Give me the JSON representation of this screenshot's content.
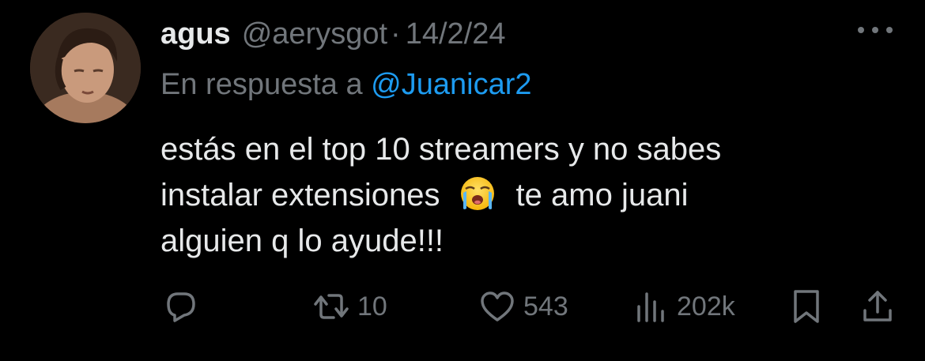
{
  "tweet": {
    "author": {
      "name": "agus",
      "handle": "@aerysgot"
    },
    "separator": "·",
    "date": "14/2/24",
    "reply_to": {
      "prefix": "En respuesta a",
      "mention": "@Juanicar2"
    },
    "text_lines": {
      "line1": "estás en el top 10 streamers y no sabes",
      "line2_before": "instalar extensiones",
      "line2_emoji": "loudly-crying-face",
      "line2_after": "te amo juani",
      "line3": "alguien q lo ayude!!!"
    },
    "actions": {
      "reply": {
        "icon": "reply-icon",
        "count": ""
      },
      "retweet": {
        "icon": "retweet-icon",
        "count": "10"
      },
      "like": {
        "icon": "heart-icon",
        "count": "543"
      },
      "views": {
        "icon": "views-icon",
        "count": "202k"
      },
      "bookmark": {
        "icon": "bookmark-icon"
      },
      "share": {
        "icon": "share-icon"
      }
    }
  },
  "colors": {
    "background": "#000000",
    "primary_text": "#e7e9ea",
    "secondary_text": "#71767b",
    "link": "#1d9bf0"
  }
}
